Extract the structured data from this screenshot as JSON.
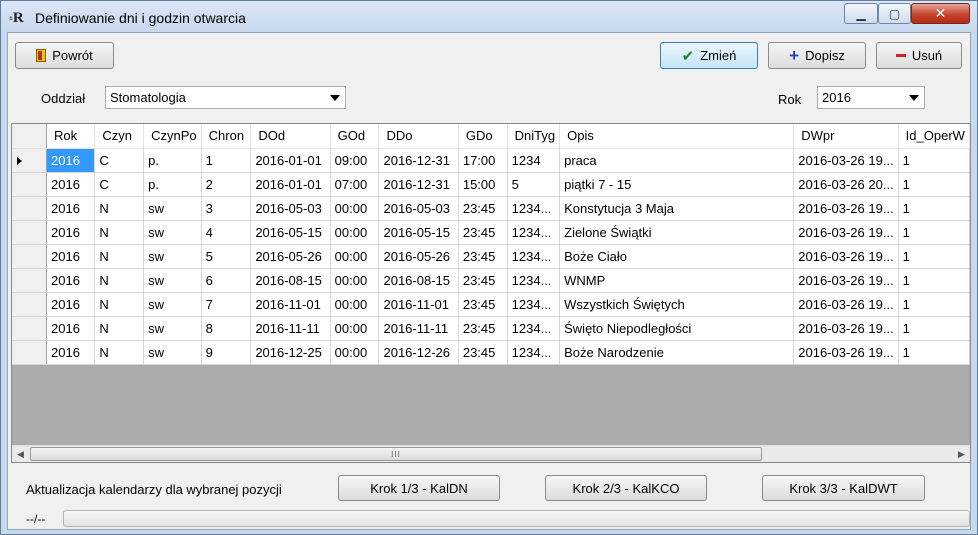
{
  "window": {
    "title": "Definiowanie dni i godzin otwarcia",
    "icon_text": "R",
    "controls": [
      "minimize-icon",
      "maximize-icon",
      "close-icon"
    ]
  },
  "toolbar": {
    "back_label": "Powrót",
    "change_label": "Zmień",
    "add_label": "Dopisz",
    "delete_label": "Usuń"
  },
  "filters": {
    "department_label": "Oddział",
    "department_value": "Stomatologia",
    "year_label": "Rok",
    "year_value": "2016"
  },
  "grid": {
    "columns": [
      "Rok",
      "Czyn",
      "CzynPo",
      "Chron",
      "DOd",
      "GOd",
      "DDo",
      "GDo",
      "DniTyg",
      "Opis",
      "DWpr",
      "Id_OperW"
    ],
    "rows": [
      [
        "2016",
        "C",
        "p.",
        "1",
        "2016-01-01",
        "09:00",
        "2016-12-31",
        "17:00",
        "1234",
        "praca",
        "2016-03-26 19...",
        "1"
      ],
      [
        "2016",
        "C",
        "p.",
        "2",
        "2016-01-01",
        "07:00",
        "2016-12-31",
        "15:00",
        "5",
        "piątki 7 - 15",
        "2016-03-26 20...",
        "1"
      ],
      [
        "2016",
        "N",
        "sw",
        "3",
        "2016-05-03",
        "00:00",
        "2016-05-03",
        "23:45",
        "1234...",
        "Konstytucja 3 Maja",
        "2016-03-26 19...",
        "1"
      ],
      [
        "2016",
        "N",
        "sw",
        "4",
        "2016-05-15",
        "00:00",
        "2016-05-15",
        "23:45",
        "1234...",
        "Zielone Świątki",
        "2016-03-26 19...",
        "1"
      ],
      [
        "2016",
        "N",
        "sw",
        "5",
        "2016-05-26",
        "00:00",
        "2016-05-26",
        "23:45",
        "1234...",
        "Boże Ciało",
        "2016-03-26 19...",
        "1"
      ],
      [
        "2016",
        "N",
        "sw",
        "6",
        "2016-08-15",
        "00:00",
        "2016-08-15",
        "23:45",
        "1234...",
        "WNMP",
        "2016-03-26 19...",
        "1"
      ],
      [
        "2016",
        "N",
        "sw",
        "7",
        "2016-11-01",
        "00:00",
        "2016-11-01",
        "23:45",
        "1234...",
        "Wszystkich Świętych",
        "2016-03-26 19...",
        "1"
      ],
      [
        "2016",
        "N",
        "sw",
        "8",
        "2016-11-11",
        "00:00",
        "2016-11-11",
        "23:45",
        "1234...",
        "Święto Niepodległości",
        "2016-03-26 19...",
        "1"
      ],
      [
        "2016",
        "N",
        "sw",
        "9",
        "2016-12-25",
        "00:00",
        "2016-12-26",
        "23:45",
        "1234...",
        "Boże Narodzenie",
        "2016-03-26 19...",
        "1"
      ]
    ],
    "selected_row": 0
  },
  "footer": {
    "info_text": "Aktualizacja kalendarzy dla wybranej pozycji",
    "step1_label": "Krok 1/3 - KalDN",
    "step2_label": "Krok 2/3 - KalKCO",
    "step3_label": "Krok 3/3 - KalDWT",
    "status_text": "--/--",
    "progress": 0
  },
  "colors": {
    "selection": "#3399ff",
    "close_button": "#c7442d"
  }
}
